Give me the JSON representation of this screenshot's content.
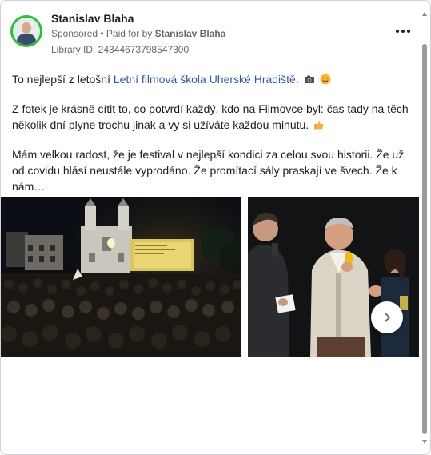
{
  "post": {
    "page_name": "Stanislav Blaha",
    "sponsored_label": "Sponsored",
    "separator": " • ",
    "paid_for_by_label": "Paid for by ",
    "payer_name": "Stanislav Blaha",
    "library_id": "Library ID: 24344673798547300",
    "paragraph1_before_link": "To nejlepší z letošní ",
    "paragraph1_link": "Letní filmová škola Uherské Hradiště",
    "paragraph1_after_link": ".",
    "paragraph2": "Z fotek je krásně cítit to, co potvrdí každý, kdo na Filmovce byl: čas tady na těch několik dní plyne trochu jinak a vy si užíváte každou minutu.",
    "paragraph3": "Mám velkou radost, že je festival v nejlepší kondici za celou svou historii. Že už od covidu hlásí neustále vyprodáno. Že promítací sály praskají ve švech. Že k nám…",
    "emoji_icons": [
      "camera-icon",
      "smiling-face-icon",
      "thumbs-up-icon"
    ],
    "carousel_icons": [
      "chevron-right-icon"
    ]
  },
  "colors": {
    "link": "#385898",
    "avatar_ring": "#2fbf3b",
    "secondary_text": "#65676b"
  }
}
